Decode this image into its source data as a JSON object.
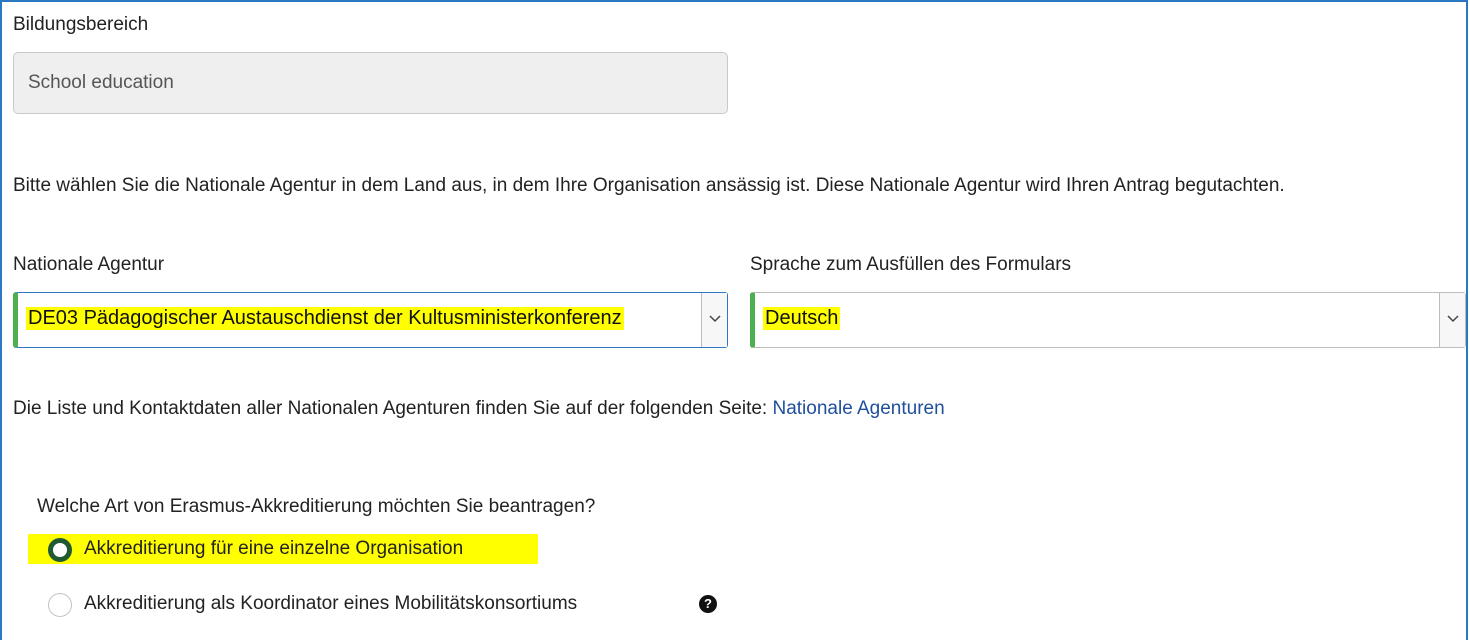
{
  "education_field": {
    "label": "Bildungsbereich",
    "value": "School education"
  },
  "instruction_text": "Bitte wählen Sie die Nationale Agentur in dem Land aus, in dem Ihre Organisation ansässig ist. Diese Nationale Agentur wird Ihren Antrag begutachten.",
  "national_agency": {
    "label": "Nationale Agentur",
    "selected": "DE03 Pädagogischer Austauschdienst der Kultusministerkonferenz"
  },
  "form_language": {
    "label": "Sprache zum Ausfüllen des Formulars",
    "selected": "Deutsch"
  },
  "contact_info": {
    "text": "Die Liste und Kontaktdaten aller Nationalen Agenturen finden Sie auf der folgenden Seite:",
    "link": "Nationale Agenturen"
  },
  "accreditation": {
    "question": "Welche Art von Erasmus-Akkreditierung möchten Sie beantragen?",
    "options": [
      {
        "label": "Akkreditierung für eine einzelne Organisation",
        "checked": true
      },
      {
        "label": "Akkreditierung als Koordinator eines Mobilitätskonsortiums",
        "checked": false
      }
    ]
  },
  "icons": {
    "select_caret": "chevron-down-icon",
    "help": "question-circle-icon"
  },
  "colors": {
    "frame": "#2b78c2",
    "valid_bar": "#4caf50",
    "highlight": "#ffff00",
    "link": "#1f4f9c"
  }
}
